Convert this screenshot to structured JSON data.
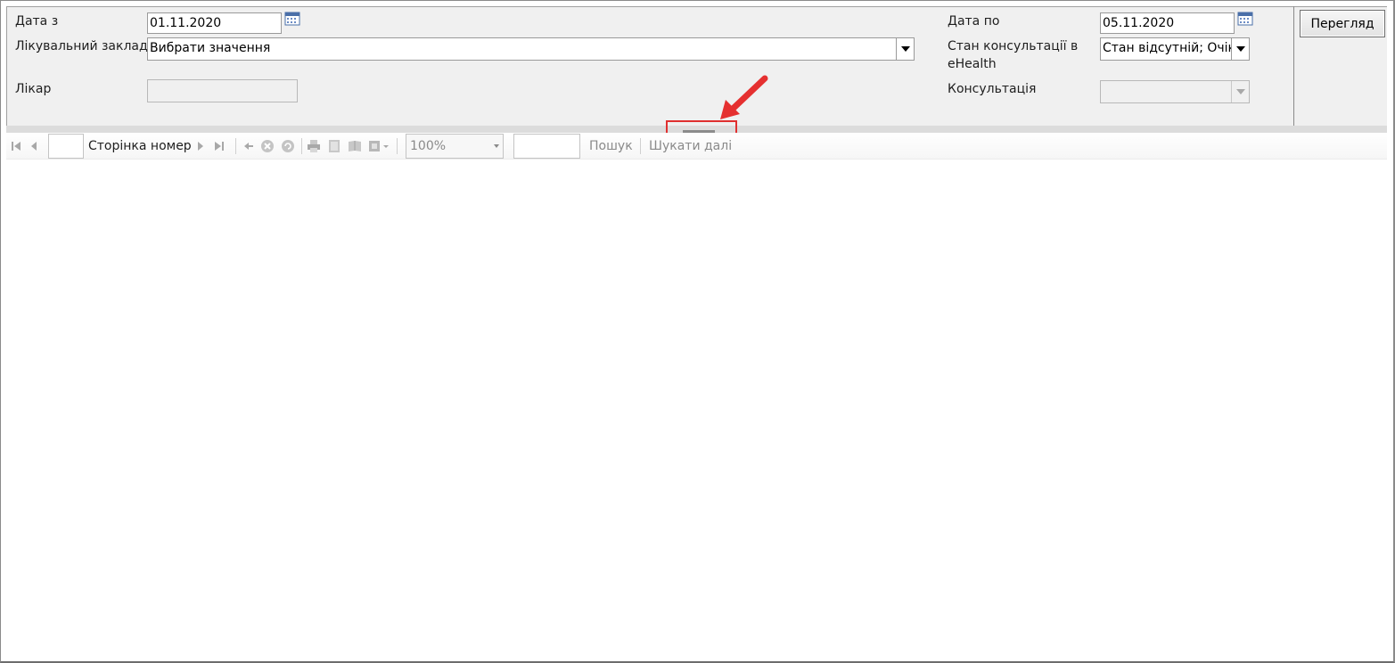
{
  "params": {
    "date_from_label": "Дата з",
    "date_from_value": "01.11.2020",
    "facility_label": "Лікувальний заклад",
    "facility_value": "Вибрати значення",
    "doctor_label": "Лікар",
    "doctor_value": "",
    "date_to_label": "Дата по",
    "date_to_value": "05.11.2020",
    "status_label_line1": "Стан  консультації в",
    "status_label_line2": "eHealth",
    "status_value": "Стан відсутній; Очікує",
    "consult_label": "Консультація",
    "consult_value": ""
  },
  "view_button": "Перегляд",
  "toolbar": {
    "page_number_value": "",
    "page_label": "Сторінка номер",
    "zoom_value": "100%",
    "search_value": "",
    "search_label": "Пошук",
    "find_next_label": "Шукати далі"
  },
  "colors": {
    "panel_bg": "#f0f0f0",
    "highlight": "#e03030",
    "disabled_icon": "#a8a8a8"
  },
  "icons": {
    "calendar": "calendar-icon",
    "first_page": "first-page-icon",
    "prev_page": "prev-page-icon",
    "next_page": "next-page-icon",
    "last_page": "last-page-icon",
    "back": "back-icon",
    "stop": "stop-icon",
    "refresh": "refresh-icon",
    "print": "print-icon",
    "print_layout": "print-layout-icon",
    "page_setup": "page-setup-icon",
    "export": "export-icon"
  }
}
